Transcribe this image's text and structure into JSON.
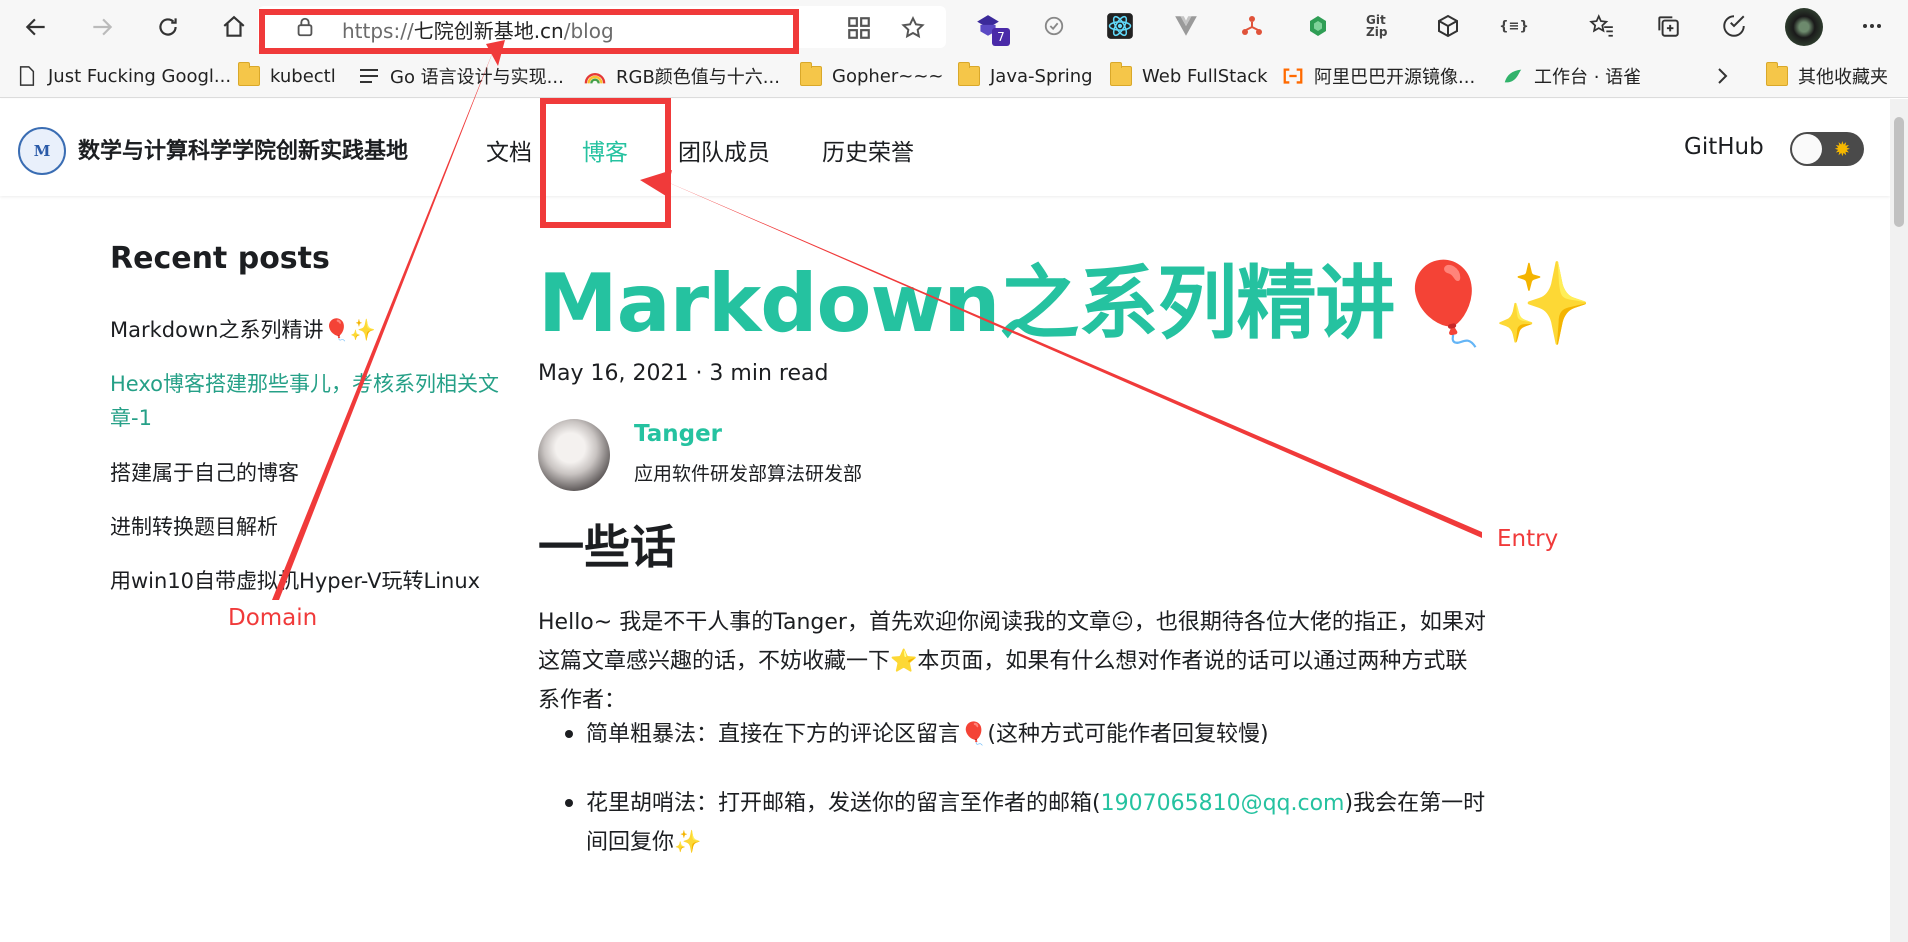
{
  "browser": {
    "url_prefix": "https://",
    "url_domain": "七院创新基地.cn",
    "url_path": "/blog",
    "extensions": [
      {
        "name": "extension-1",
        "badge": "7"
      },
      {
        "name": "extension-2"
      },
      {
        "name": "react-devtools"
      },
      {
        "name": "vue-devtools"
      },
      {
        "name": "extension-5"
      },
      {
        "name": "extension-6"
      },
      {
        "label": "Git Zip"
      },
      {
        "name": "extension-8"
      },
      {
        "label": "{≡}"
      }
    ],
    "bookmarks": [
      {
        "label": "Just Fucking Googl...",
        "icon": "page-icon"
      },
      {
        "label": "kubectl",
        "icon": "folder-icon"
      },
      {
        "label": "Go 语言设计与实现...",
        "icon": "list-icon"
      },
      {
        "label": "RGB颜色值与十六...",
        "icon": "rainbow-icon"
      },
      {
        "label": "Gopher~~~",
        "icon": "folder-icon"
      },
      {
        "label": "Java-Spring",
        "icon": "folder-icon"
      },
      {
        "label": "Web FullStack",
        "icon": "folder-icon"
      },
      {
        "label": "阿里巴巴开源镜像...",
        "icon": "aliyun-icon"
      },
      {
        "label": "工作台 · 语雀",
        "icon": "yuque-icon"
      },
      {
        "label": "其他收藏夹",
        "icon": "folder-icon"
      }
    ]
  },
  "site": {
    "title": "数学与计算科学学院创新实践基地",
    "logo_text": "M",
    "nav": [
      {
        "label": "文档",
        "active": false
      },
      {
        "label": "博客",
        "active": true
      },
      {
        "label": "团队成员",
        "active": false
      },
      {
        "label": "历史荣誉",
        "active": false
      }
    ],
    "github": "GitHub",
    "accent_color": "#25c2a0"
  },
  "sidebar": {
    "title": "Recent posts",
    "posts": [
      {
        "label": "Markdown之系列精讲🎈✨",
        "active": false
      },
      {
        "label": "Hexo博客搭建那些事儿，考核系列相关文章-1",
        "active": true
      },
      {
        "label": "搭建属于自己的博客",
        "active": false
      },
      {
        "label": "进制转换题目解析",
        "active": false
      },
      {
        "label": "用win10自带虚拟机Hyper-V玩转Linux",
        "active": false
      }
    ]
  },
  "post": {
    "title": "Markdown之系列精讲🎈✨",
    "meta": "May 16, 2021 · 3 min read",
    "author_name": "Tanger",
    "author_title": "应用软件研发部算法研发部",
    "heading": "一些话",
    "intro": "Hello~ 我是不干人事的Tanger，首先欢迎你阅读我的文章😐，也很期待各位大佬的指正，如果对这篇文章感兴趣的话，不妨收藏一下⭐本页面，如果有什么想对作者说的话可以通过两种方式联系作者：",
    "list": [
      {
        "before": "简单粗暴法：直接在下方的评论区留言🎈(这种方式可能作者回复较慢)",
        "link": "",
        "after": ""
      },
      {
        "before": "花里胡哨法：打开邮箱，发送你的留言至作者的邮箱(",
        "link": "1907065810@qq.com",
        "after": ")我会在第一时间回复你✨"
      }
    ]
  },
  "annotations": {
    "domain_label": "Domain",
    "entry_label": "Entry",
    "color": "#f03a3a"
  }
}
